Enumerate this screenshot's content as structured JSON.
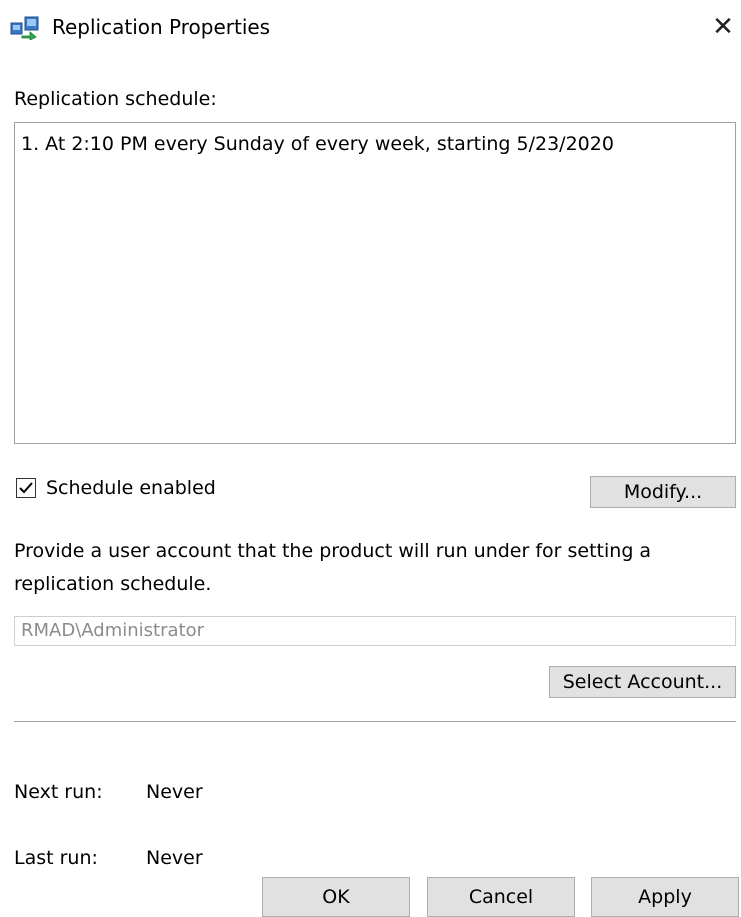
{
  "window": {
    "title": "Replication Properties",
    "close_glyph": "✕"
  },
  "schedule": {
    "label": "Replication schedule:",
    "items": [
      "1. At 2:10 PM every Sunday of every week, starting 5/23/2020"
    ],
    "enabled_label": "Schedule enabled",
    "enabled": true,
    "modify_label": "Modify..."
  },
  "account": {
    "description_line1": "Provide a user account that the product will run under for setting a",
    "description_line2": "replication schedule.",
    "value": "RMAD\\Administrator",
    "select_label": "Select Account..."
  },
  "runs": {
    "next_label": "Next run:",
    "next_value": "Never",
    "last_label": "Last run:",
    "last_value": "Never"
  },
  "footer": {
    "ok_label": "OK",
    "cancel_label": "Cancel",
    "apply_label": "Apply"
  },
  "icons": {
    "app": "replication-icon",
    "close": "close-icon",
    "check": "checkmark-icon"
  }
}
